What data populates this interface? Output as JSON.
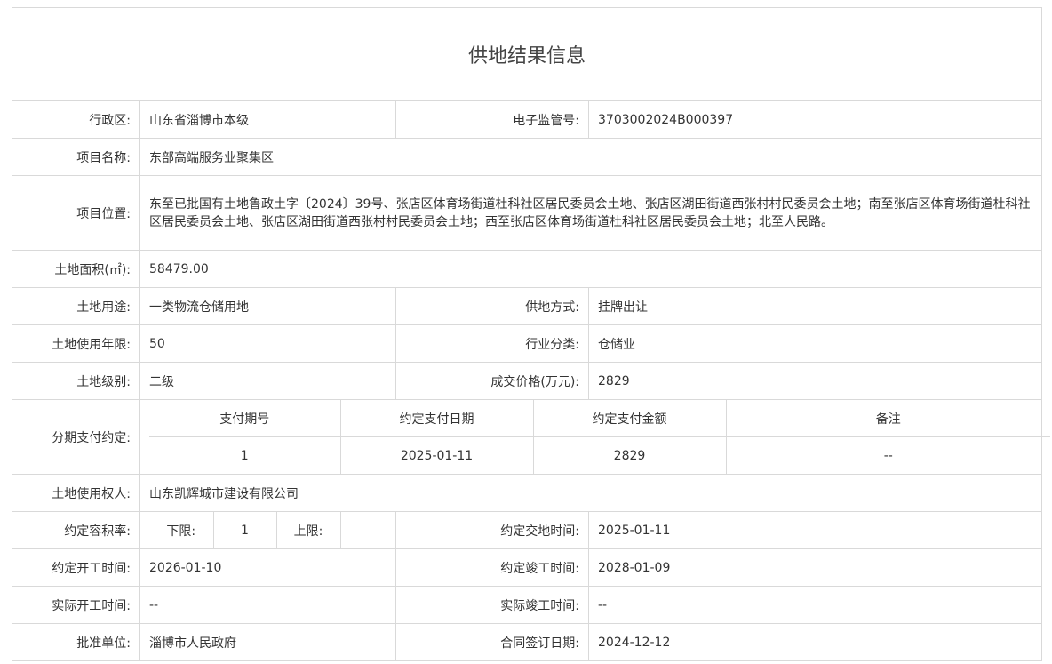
{
  "title": "供地结果信息",
  "fields": {
    "district_label": "行政区:",
    "district": "山东省淄博市本级",
    "supervision_no_label": "电子监管号:",
    "supervision_no": "3703002024B000397",
    "project_name_label": "项目名称:",
    "project_name": "东部高端服务业聚集区",
    "project_location_label": "项目位置:",
    "project_location": "东至已批国有土地鲁政土字〔2024〕39号、张店区体育场街道杜科社区居民委员会土地、张店区湖田街道西张村村民委员会土地；南至张店区体育场街道杜科社区居民委员会土地、张店区湖田街道西张村村民委员会土地；西至张店区体育场街道杜科社区居民委员会土地；北至人民路。",
    "land_area_label": "土地面积(㎡):",
    "land_area": "58479.00",
    "land_use_label": "土地用途:",
    "land_use": "一类物流仓储用地",
    "supply_method_label": "供地方式:",
    "supply_method": "挂牌出让",
    "use_years_label": "土地使用年限:",
    "use_years": "50",
    "industry_label": "行业分类:",
    "industry": "仓储业",
    "land_grade_label": "土地级别:",
    "land_grade": "二级",
    "price_label": "成交价格(万元):",
    "price": "2829",
    "installment_label": "分期支付约定:",
    "installment": {
      "headers": [
        "支付期号",
        "约定支付日期",
        "约定支付金额",
        "备注"
      ],
      "rows": [
        [
          "1",
          "2025-01-11",
          "2829",
          "--"
        ]
      ]
    },
    "land_user_label": "土地使用权人:",
    "land_user": "山东凯辉城市建设有限公司",
    "far_label": "约定容积率:",
    "far_lower_label": "下限:",
    "far_lower": "1",
    "far_upper_label": "上限:",
    "far_upper": "",
    "handover_time_label": "约定交地时间:",
    "handover_time": "2025-01-11",
    "planned_start_label": "约定开工时间:",
    "planned_start": "2026-01-10",
    "planned_finish_label": "约定竣工时间:",
    "planned_finish": "2028-01-09",
    "actual_start_label": "实际开工时间:",
    "actual_start": "--",
    "actual_finish_label": "实际竣工时间:",
    "actual_finish": "--",
    "approver_label": "批准单位:",
    "approver": "淄博市人民政府",
    "contract_date_label": "合同签订日期:",
    "contract_date": "2024-12-12"
  }
}
